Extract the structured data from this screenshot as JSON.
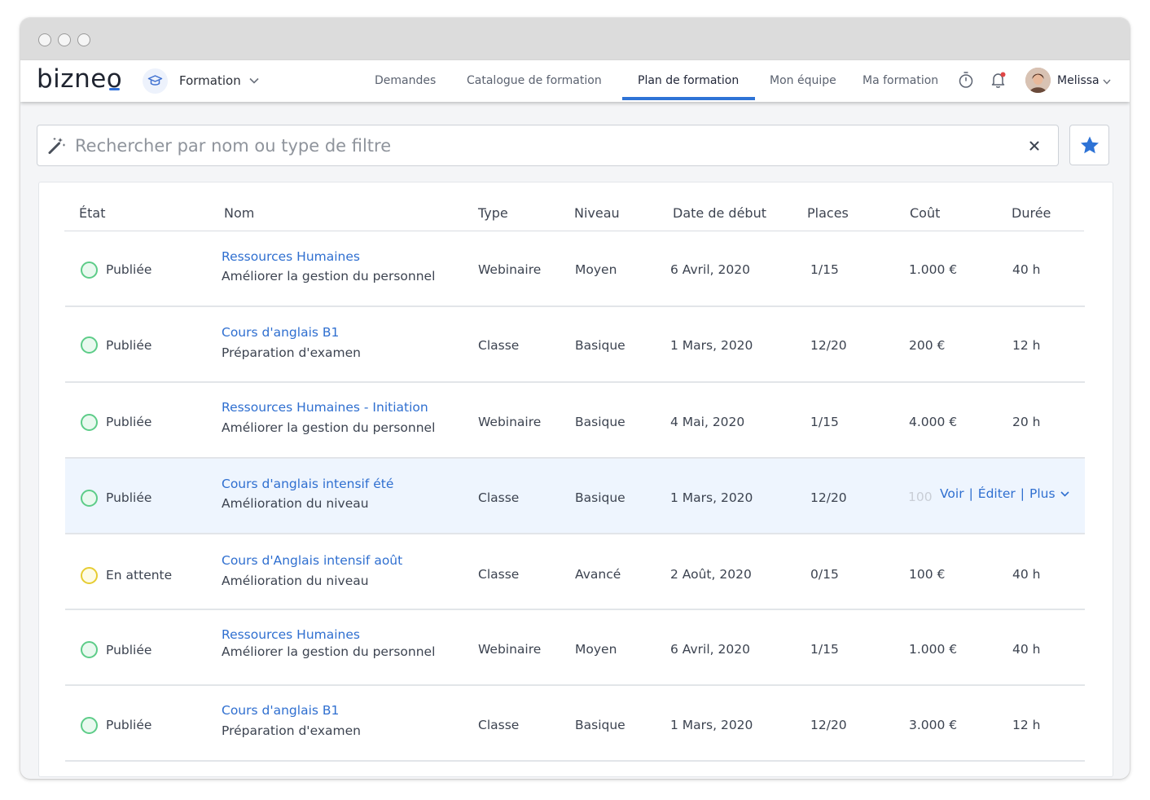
{
  "app": {
    "logo": "bizneo",
    "module": "Formation",
    "nav": [
      "Demandes",
      "Catalogue de formation",
      "Plan de formation",
      "Mon équipe",
      "Ma formation"
    ],
    "active_nav": "Plan de formation",
    "user": "Melissa"
  },
  "search": {
    "placeholder": "Rechercher par nom ou type de filtre",
    "value": ""
  },
  "table": {
    "columns": [
      "État",
      "Nom",
      "Type",
      "Niveau",
      "Date de début",
      "Places",
      "Coût",
      "Durée"
    ],
    "rows": [
      {
        "status": "Publiée",
        "state": "published",
        "title": "Ressources Humaines",
        "subtitle": "Améliorer la gestion du personnel",
        "type": "Webinaire",
        "level": "Moyen",
        "start": "6 Avril, 2020",
        "places": "1/15",
        "cost": "1.000 €",
        "duration": "40 h"
      },
      {
        "status": "Publiée",
        "state": "published",
        "title": "Cours d'anglais B1",
        "subtitle": "Préparation d'examen",
        "type": "Classe",
        "level": "Basique",
        "start": "1 Mars, 2020",
        "places": "12/20",
        "cost": "200 €",
        "duration": "12 h"
      },
      {
        "status": "Publiée",
        "state": "published",
        "title": "Ressources Humaines - Initiation",
        "subtitle": "Améliorer la gestion du personnel",
        "type": "Webinaire",
        "level": "Basique",
        "start": "4 Mai, 2020",
        "places": "1/15",
        "cost": "4.000 €",
        "duration": "20 h"
      },
      {
        "status": "Publiée",
        "state": "published",
        "title": "Cours d'anglais intensif été",
        "subtitle": "Amélioration du niveau",
        "type": "Classe",
        "level": "Basique",
        "start": "1 Mars, 2020",
        "places": "12/20",
        "cost": "100",
        "duration": "",
        "hover": true
      },
      {
        "status": "En attente",
        "state": "pending",
        "title": "Cours d'Anglais intensif août",
        "subtitle": "Amélioration du niveau",
        "type": "Classe",
        "level": "Avancé",
        "start": "2 Août, 2020",
        "places": "0/15",
        "cost": "100 €",
        "duration": "40 h"
      },
      {
        "status": "Publiée",
        "state": "published",
        "title": "Ressources Humaines",
        "subtitle": "Améliorer la gestion du personnel",
        "type": "Webinaire",
        "level": "Moyen",
        "start": "6 Avril, 2020",
        "places": "1/15",
        "cost": "1.000 €",
        "duration": "40 h"
      },
      {
        "status": "Publiée",
        "state": "published",
        "title": "Cours d'anglais B1",
        "subtitle": "Préparation d'examen",
        "type": "Classe",
        "level": "Basique",
        "start": "1 Mars, 2020",
        "places": "12/20",
        "cost": "3.000 €",
        "duration": "12 h"
      }
    ],
    "row_actions": {
      "view": "Voir",
      "edit": "Éditer",
      "more": "Plus"
    }
  },
  "icons": {
    "module": "graduation-cap-icon",
    "search": "magic-wand-icon",
    "clear": "close-icon",
    "favorite": "star-icon",
    "timer": "stopwatch-icon",
    "notifications": "bell-icon"
  },
  "colors": {
    "accent": "#2e73d6",
    "link": "#2f6fd0",
    "published": "#5dcc88",
    "pending": "#e6cc32",
    "hover_row": "#eef5fe"
  }
}
